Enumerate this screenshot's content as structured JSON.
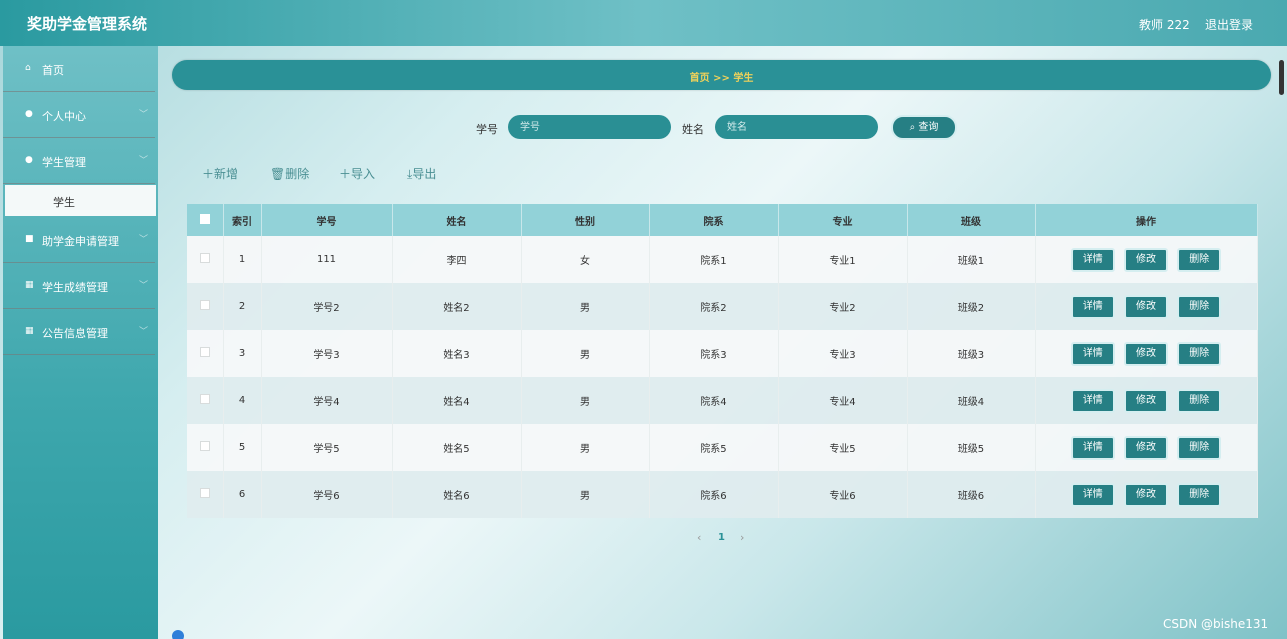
{
  "header": {
    "title": "奖助学金管理系统",
    "user": "教师 222",
    "logout": "退出登录"
  },
  "sidebar": {
    "items": [
      {
        "label": "首页"
      },
      {
        "label": "个人中心"
      },
      {
        "label": "学生管理"
      },
      {
        "label": "助学金申请管理"
      },
      {
        "label": "学生成绩管理"
      },
      {
        "label": "公告信息管理"
      }
    ],
    "sub_active": "学生"
  },
  "breadcrumb": "首页 >> 学生",
  "search": {
    "id_label": "学号",
    "id_placeholder": "学号",
    "name_label": "姓名",
    "name_placeholder": "姓名",
    "query_label": "查询"
  },
  "toolbar": {
    "add": "新增",
    "delete": "删除",
    "import": "导入",
    "export": "导出"
  },
  "table": {
    "columns": [
      "索引",
      "学号",
      "姓名",
      "性别",
      "院系",
      "专业",
      "班级",
      "操作"
    ],
    "ops": {
      "detail": "详情",
      "edit": "修改",
      "delete": "删除"
    },
    "rows": [
      {
        "index": "1",
        "id": "111",
        "name": "李四",
        "gender": "女",
        "dept": "院系1",
        "major": "专业1",
        "class": "班级1"
      },
      {
        "index": "2",
        "id": "学号2",
        "name": "姓名2",
        "gender": "男",
        "dept": "院系2",
        "major": "专业2",
        "class": "班级2"
      },
      {
        "index": "3",
        "id": "学号3",
        "name": "姓名3",
        "gender": "男",
        "dept": "院系3",
        "major": "专业3",
        "class": "班级3"
      },
      {
        "index": "4",
        "id": "学号4",
        "name": "姓名4",
        "gender": "男",
        "dept": "院系4",
        "major": "专业4",
        "class": "班级4"
      },
      {
        "index": "5",
        "id": "学号5",
        "name": "姓名5",
        "gender": "男",
        "dept": "院系5",
        "major": "专业5",
        "class": "班级5"
      },
      {
        "index": "6",
        "id": "学号6",
        "name": "姓名6",
        "gender": "男",
        "dept": "院系6",
        "major": "专业6",
        "class": "班级6"
      }
    ]
  },
  "pagination": {
    "current": "1"
  },
  "watermark": "CSDN @bishe131",
  "colors": {
    "primary": "#2a9197",
    "header_bg": "#92d2d8",
    "breadcrumb_text": "#f0d25a"
  }
}
